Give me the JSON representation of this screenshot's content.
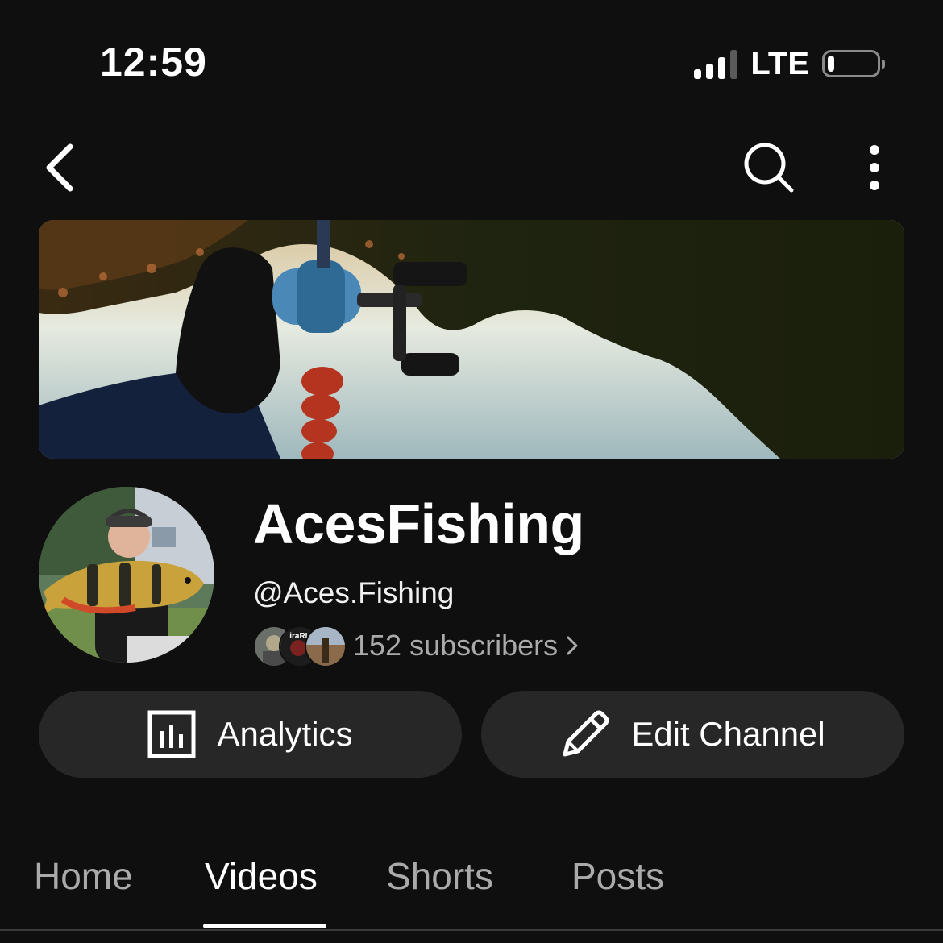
{
  "status_bar": {
    "time": "12:59",
    "network": "LTE",
    "signal_bars_filled": 3,
    "signal_bars_total": 4,
    "battery_level": 0.1
  },
  "top_nav": {
    "back_icon": "chevron-left-icon",
    "search_icon": "search-icon",
    "more_icon": "more-vertical-icon"
  },
  "channel": {
    "name": "AcesFishing",
    "handle": "@Aces.Fishing",
    "subscribers": "152 subscribers",
    "subscriber_avatar_label": "iraRL"
  },
  "actions": {
    "analytics_label": "Analytics",
    "analytics_icon": "analytics-chart-icon",
    "edit_label": "Edit Channel",
    "edit_icon": "pencil-icon"
  },
  "tabs": [
    {
      "label": "Home",
      "active": false
    },
    {
      "label": "Videos",
      "active": true
    },
    {
      "label": "Shorts",
      "active": false
    },
    {
      "label": "Posts",
      "active": false
    }
  ],
  "colors": {
    "background": "#0f0f0f",
    "button_bg": "#272727",
    "secondary_text": "#aaaaaa",
    "primary_text": "#ffffff"
  }
}
